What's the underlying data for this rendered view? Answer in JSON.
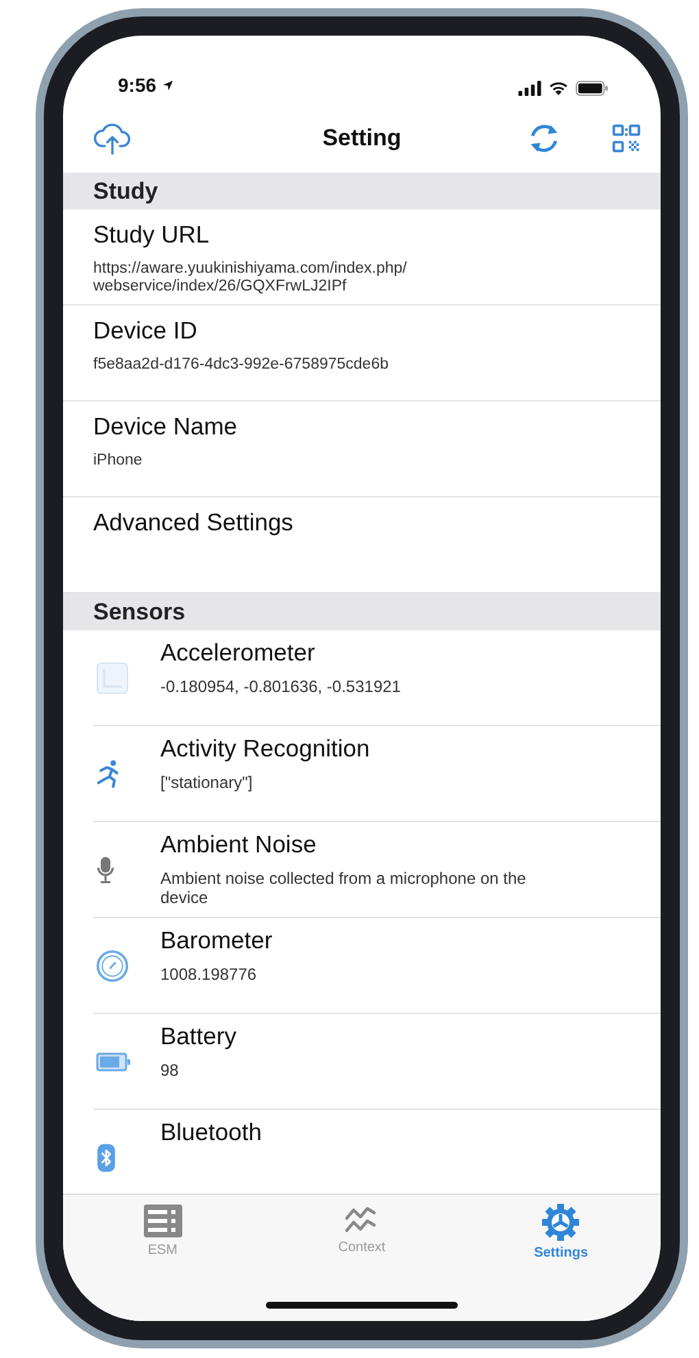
{
  "status_bar": {
    "time": "9:56"
  },
  "nav": {
    "title": "Setting"
  },
  "study": {
    "title": "Study",
    "rows": [
      {
        "title": "Study URL",
        "detail": "https://aware.yuukinishiyama.com/index.php/\nwebservice/index/26/GQXFrwLJ2IPf"
      },
      {
        "title": "Device ID",
        "detail": "f5e8aa2d-d176-4dc3-992e-6758975cde6b"
      },
      {
        "title": "Device Name",
        "detail": "iPhone"
      },
      {
        "title": "Advanced Settings"
      }
    ]
  },
  "sensors": {
    "title": "Sensors",
    "rows": [
      {
        "kind": "accelerometer",
        "title": "Accelerometer",
        "detail": "-0.180954, -0.801636, -0.531921"
      },
      {
        "kind": "activity",
        "title": "Activity Recognition",
        "detail": "[\"stationary\"]"
      },
      {
        "kind": "microphone",
        "title": "Ambient Noise",
        "detail": "Ambient noise collected from a microphone on the device"
      },
      {
        "kind": "barometer",
        "title": "Barometer",
        "detail": "1008.198776"
      },
      {
        "kind": "battery",
        "title": "Battery",
        "detail": "98"
      },
      {
        "kind": "bluetooth",
        "title": "Bluetooth"
      }
    ]
  },
  "tabs": [
    {
      "kind": "esm",
      "label": "ESM",
      "selected": false
    },
    {
      "kind": "context",
      "label": "Context",
      "selected": false
    },
    {
      "kind": "settings",
      "label": "Settings",
      "selected": true
    }
  ]
}
